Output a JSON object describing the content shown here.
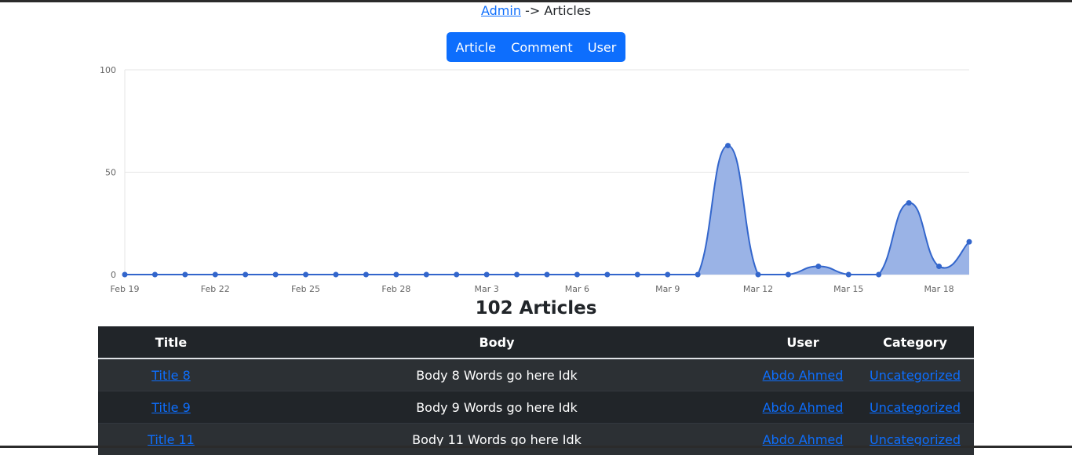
{
  "breadcrumb": {
    "link": "Admin",
    "separator": " -> ",
    "current": "Articles"
  },
  "nav": {
    "article": "Article",
    "comment": "Comment",
    "user": "User"
  },
  "summary": {
    "title": "102 Articles"
  },
  "chart_data": {
    "type": "area",
    "x": [
      "Feb 19",
      "Feb 20",
      "Feb 21",
      "Feb 22",
      "Feb 23",
      "Feb 24",
      "Feb 25",
      "Feb 26",
      "Feb 27",
      "Feb 28",
      "Mar 1",
      "Mar 2",
      "Mar 3",
      "Mar 4",
      "Mar 5",
      "Mar 6",
      "Mar 7",
      "Mar 8",
      "Mar 9",
      "Mar 10",
      "Mar 11",
      "Mar 12",
      "Mar 13",
      "Mar 14",
      "Mar 15",
      "Mar 16",
      "Mar 17",
      "Mar 18",
      "Mar 19"
    ],
    "values": [
      0,
      0,
      0,
      0,
      0,
      0,
      0,
      0,
      0,
      0,
      0,
      0,
      0,
      0,
      0,
      0,
      0,
      0,
      0,
      0,
      63,
      0,
      0,
      4,
      0,
      0,
      35,
      4,
      16
    ],
    "x_tick_labels": [
      "Feb 19",
      "Feb 22",
      "Feb 25",
      "Feb 28",
      "Mar 3",
      "Mar 6",
      "Mar 9",
      "Mar 12",
      "Mar 15",
      "Mar 18"
    ],
    "y_ticks": [
      0,
      50,
      100
    ],
    "ylim": [
      0,
      100
    ],
    "grid": true,
    "line_color": "#3366cc",
    "fill_color": "#9ab3e6"
  },
  "table": {
    "headers": [
      "Title",
      "Body",
      "User",
      "Category"
    ],
    "rows": [
      {
        "title": "Title 8",
        "body": "Body 8 Words go here Idk",
        "user": "Abdo Ahmed",
        "category": "Uncategorized"
      },
      {
        "title": "Title 9",
        "body": "Body 9 Words go here Idk",
        "user": "Abdo Ahmed",
        "category": "Uncategorized"
      },
      {
        "title": "Title 11",
        "body": "Body 11 Words go here Idk",
        "user": "Abdo Ahmed",
        "category": "Uncategorized"
      }
    ]
  }
}
